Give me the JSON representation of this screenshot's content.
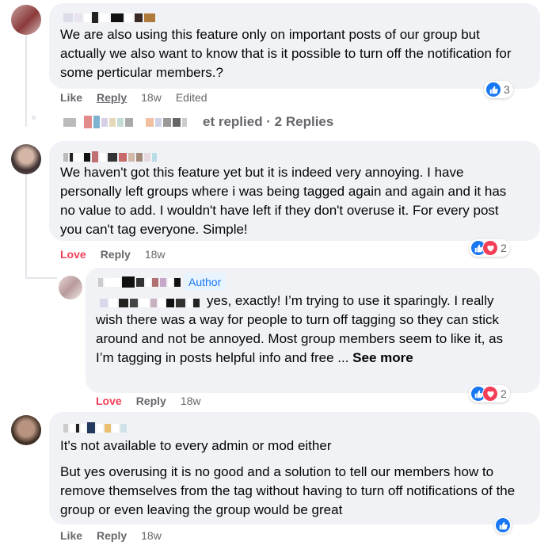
{
  "colors": {
    "bubble": "#f0f2f5",
    "like_blue": "#1877f2",
    "love_red": "#f33e58",
    "meta_gray": "#65676b"
  },
  "comments": [
    {
      "text": "We are also using this feature only on important posts of our group but actually we also want to know that is it possible to turn off the notification for some perticular members.?",
      "action_like": "Like",
      "action_reply": "Reply",
      "time": "18w",
      "edited": "Edited",
      "reaction_icons": [
        "like-icon"
      ],
      "reaction_count": "3"
    },
    {
      "text": "We haven't got this feature yet but it is indeed very annoying. I have personally left groups where i was being tagged again and again and it has no value to add. I wouldn't have left if they don't overuse it. For every post you can't tag everyone. Simple!",
      "action_like": "Love",
      "action_reply": "Reply",
      "time": "18w",
      "reaction_icons": [
        "like-icon",
        "love-icon"
      ],
      "reaction_count": "2"
    },
    {
      "text_line1": "It's not available to every admin or mod either",
      "text_line2": "But yes overusing it is no good and a solution to tell our members how to remove themselves from the tag without having to turn off notifications of the group or even leaving the group would be great",
      "action_like": "Like",
      "action_reply": "Reply",
      "time": "18w",
      "reaction_icons": [
        "like-icon"
      ]
    }
  ],
  "replies_summary": "et replied · 2 Replies",
  "nested_reply": {
    "badge": "Author",
    "text": "yes, exactly! I’m trying to use it sparingly. I really wish there was a way for people to turn off tagging so they can stick around and not be annoyed. Most group members seem to like it, as I’m tagging in posts helpful info and free ...",
    "see_more": "See more",
    "action_like": "Love",
    "action_reply": "Reply",
    "time": "18w",
    "reaction_icons": [
      "like-icon",
      "love-icon"
    ],
    "reaction_count": "2"
  }
}
